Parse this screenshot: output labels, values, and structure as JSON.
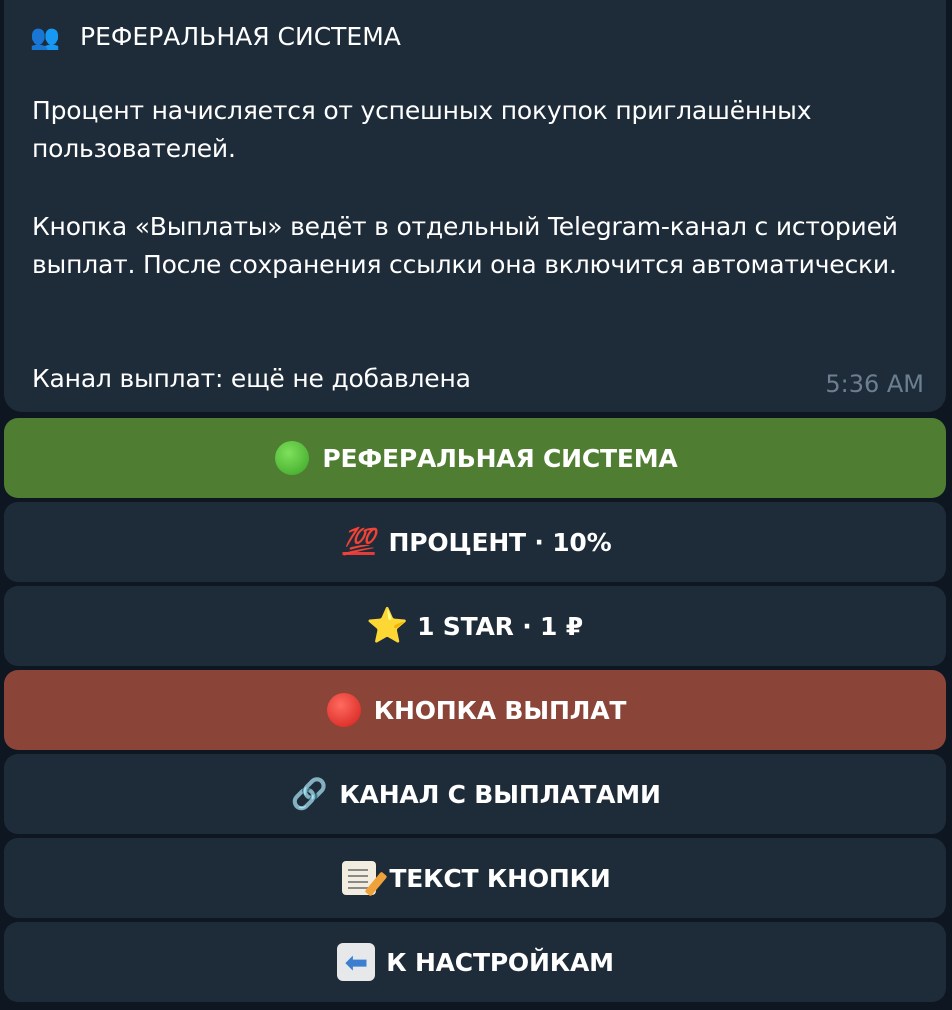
{
  "message": {
    "title_emoji": "👥",
    "title": "РЕФЕРАЛЬНАЯ СИСТЕМА",
    "paragraph1": "Процент начисляется от успешных покупок приглашённых пользователей.",
    "paragraph2": "Кнопка «Выплаты» ведёт в отдельный Telegram-канал с историей выплат. После сохранения ссылки она включится автоматически.",
    "paragraph3": "Канал выплат: ещё не добавлена",
    "time": "5:36 AM"
  },
  "keyboard": {
    "buttons": [
      {
        "label": "РЕФЕРАЛЬНАЯ СИСТЕМА",
        "icon": "green-circle-icon",
        "color": "#4f7d32"
      },
      {
        "label": "ПРОЦЕНТ · 10%",
        "icon": "hundred-points-icon",
        "color": "#1e2c3a"
      },
      {
        "label": "1 STAR · 1 ₽",
        "icon": "star-icon",
        "color": "#1e2c3a"
      },
      {
        "label": "КНОПКА ВЫПЛАТ",
        "icon": "red-circle-icon",
        "color": "#8a4438"
      },
      {
        "label": "КАНАЛ С ВЫПЛАТАМИ",
        "icon": "link-icon",
        "color": "#1e2c3a"
      },
      {
        "label": "ТЕКСТ КНОПКИ",
        "icon": "memo-icon",
        "color": "#1e2c3a"
      },
      {
        "label": "К НАСТРОЙКАМ",
        "icon": "back-arrow-icon",
        "color": "#1e2c3a"
      }
    ]
  },
  "icons": {
    "hundred": "💯",
    "star": "⭐",
    "link": "🔗",
    "back_arrow": "⬅"
  }
}
